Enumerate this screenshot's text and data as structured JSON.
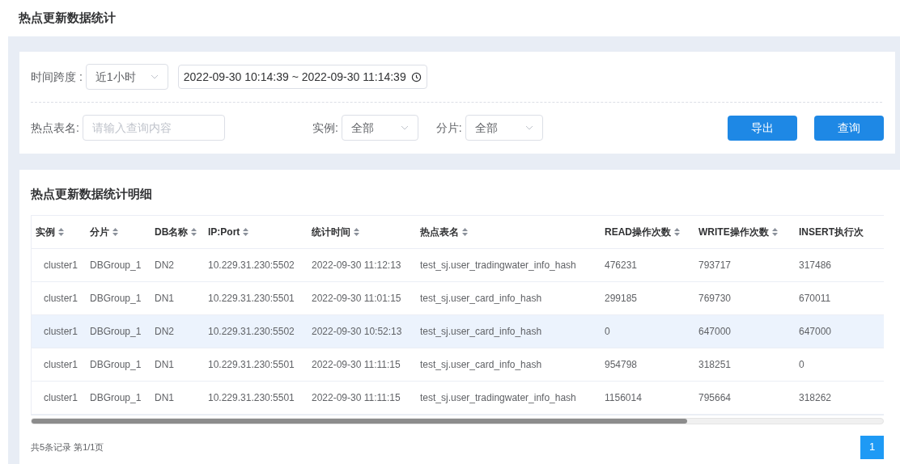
{
  "page_title": "热点更新数据统计",
  "filters": {
    "time_span": {
      "label": "时间跨度 :",
      "value": "近1小时"
    },
    "date_range": {
      "value": "2022-09-30 10:14:39 ~ 2022-09-30 11:14:39"
    },
    "table_name": {
      "label": "热点表名:",
      "placeholder": "请输入查询内容"
    },
    "instance": {
      "label": "实例:",
      "value": "全部"
    },
    "shard": {
      "label": "分片:",
      "value": "全部"
    },
    "buttons": [
      "导出",
      "查询"
    ]
  },
  "detail": {
    "title": "热点更新数据统计明细",
    "table": {
      "columns": [
        {
          "label": "实例",
          "sortable": true
        },
        {
          "label": "分片",
          "sortable": true
        },
        {
          "label": "DB名称",
          "sortable": true
        },
        {
          "label": "IP:Port",
          "sortable": true
        },
        {
          "label": "统计时间",
          "sortable": true
        },
        {
          "label": "热点表名",
          "sortable": true
        },
        {
          "label": "READ操作次数",
          "sortable": true
        },
        {
          "label": "WRITE操作次数",
          "sortable": true
        },
        {
          "label": "INSERT执行次",
          "sortable": false
        }
      ],
      "rows": [
        {
          "selected": false,
          "cells": [
            "cluster1",
            "DBGroup_1",
            "DN2",
            "10.229.31.230:5502",
            "2022-09-30 11:12:13",
            "test_sj.user_tradingwater_info_hash",
            "476231",
            "793717",
            "317486"
          ]
        },
        {
          "selected": false,
          "cells": [
            "cluster1",
            "DBGroup_1",
            "DN1",
            "10.229.31.230:5501",
            "2022-09-30 11:01:15",
            "test_sj.user_card_info_hash",
            "299185",
            "769730",
            "670011"
          ]
        },
        {
          "selected": true,
          "cells": [
            "cluster1",
            "DBGroup_1",
            "DN2",
            "10.229.31.230:5502",
            "2022-09-30 10:52:13",
            "test_sj.user_card_info_hash",
            "0",
            "647000",
            "647000"
          ]
        },
        {
          "selected": false,
          "cells": [
            "cluster1",
            "DBGroup_1",
            "DN1",
            "10.229.31.230:5501",
            "2022-09-30 11:11:15",
            "test_sj.user_card_info_hash",
            "954798",
            "318251",
            "0"
          ]
        },
        {
          "selected": false,
          "cells": [
            "cluster1",
            "DBGroup_1",
            "DN1",
            "10.229.31.230:5501",
            "2022-09-30 11:11:15",
            "test_sj.user_tradingwater_info_hash",
            "1156014",
            "795664",
            "318262"
          ]
        }
      ]
    },
    "summary": "共5条记录 第1/1页",
    "pages": [
      {
        "label": "1",
        "selected": true
      }
    ]
  }
}
